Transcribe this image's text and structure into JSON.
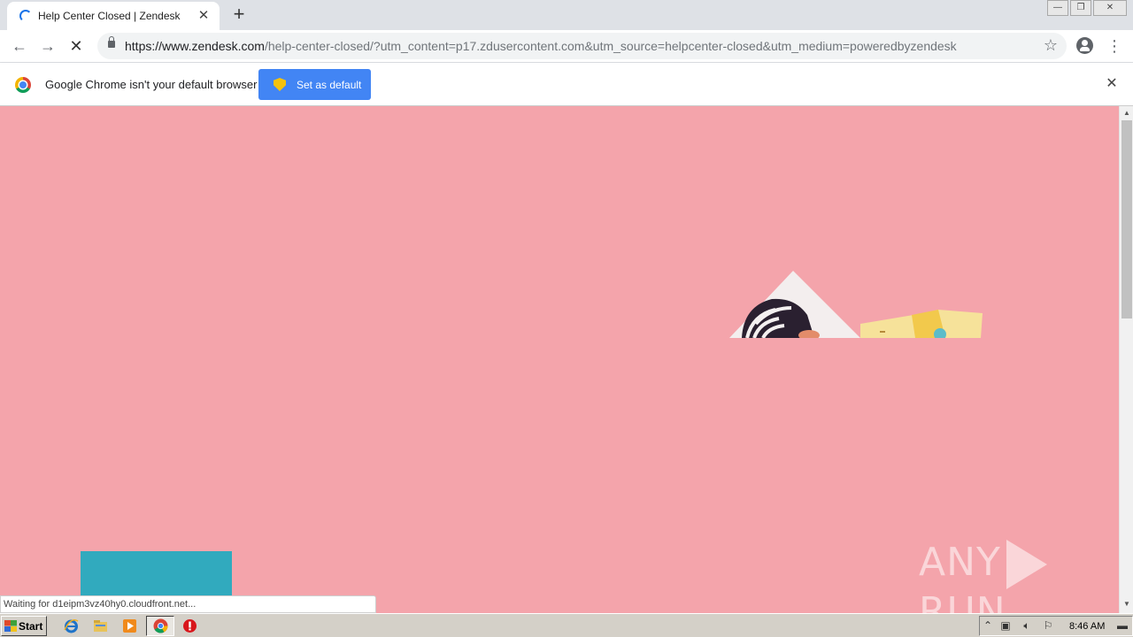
{
  "tab": {
    "title": "Help Center Closed | Zendesk",
    "close": "✕"
  },
  "toolbar": {
    "back": "←",
    "forward": "→",
    "reload": "✕",
    "url_host": "https://www.zendesk.com",
    "url_path": "/help-center-closed/?utm_content=p17.zdusercontent.com&utm_source=helpcenter-closed&utm_medium=poweredbyzendesk",
    "star": "☆",
    "menu": "⋮"
  },
  "window_controls": {
    "minimize": "—",
    "restore": "❐",
    "close": "✕"
  },
  "new_tab": "+",
  "infobar": {
    "message": "Google Chrome isn't your default browser",
    "button": "Set as default",
    "close": "✕"
  },
  "page": {
    "watermark_left": "ANY",
    "watermark_right": "RUN"
  },
  "status": "Waiting for d1eipm3vz40hy0.cloudfront.net...",
  "taskbar": {
    "start": "Start",
    "clock": "8:46 AM",
    "icons": [
      "ie-icon",
      "explorer-icon",
      "media-player-icon",
      "chrome-icon",
      "stop-icon"
    ]
  },
  "colors": {
    "page_bg": "#f4a4ab",
    "accent": "#4285f4",
    "teal": "#31aabe"
  }
}
